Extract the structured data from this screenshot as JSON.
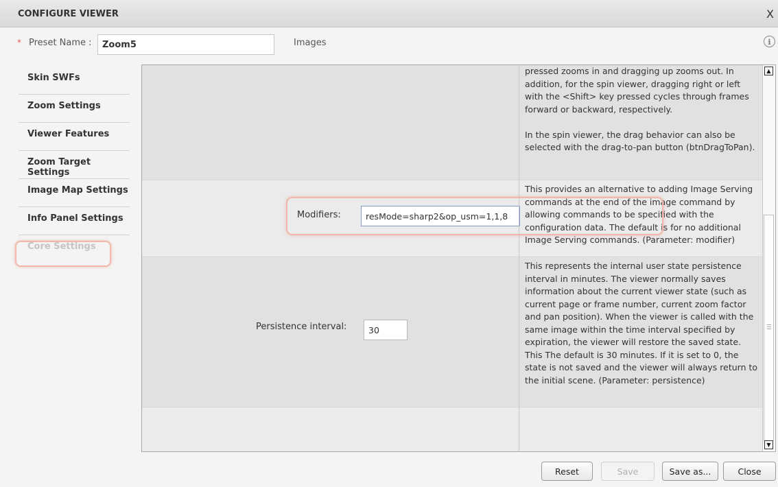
{
  "window": {
    "title": "CONFIGURE VIEWER",
    "close_label": "X"
  },
  "preset": {
    "required_mark": "*",
    "label": "Preset Name :",
    "value": "Zoom5",
    "images_label": "Images",
    "info_icon": "info-icon"
  },
  "sidebar": {
    "items": [
      {
        "label": "Skin SWFs"
      },
      {
        "label": "Zoom Settings"
      },
      {
        "label": "Viewer Features"
      },
      {
        "label": "Zoom Target Settings"
      },
      {
        "label": "Image Map Settings"
      },
      {
        "label": "Info Panel Settings"
      },
      {
        "label": "Core Settings"
      }
    ],
    "active": "Core Settings"
  },
  "rows": {
    "drag_desc": "pressed zooms in and dragging up zooms out. In addition, for the spin viewer, dragging right or left with the <Shift> key pressed cycles through frames forward or backward, respectively.\n\nIn the spin viewer, the drag behavior can also be selected with the drag-to-pan button (btnDragToPan).",
    "modifiers": {
      "label": "Modifiers:",
      "value": "resMode=sharp2&op_usm=1,1,8",
      "desc": "This provides an alternative to adding Image Serving commands at the end of the image command by allowing commands to be specified with the configuration data. The default is for no additional Image Serving commands. (Parameter: modifier)"
    },
    "persistence": {
      "label": "Persistence interval:",
      "value": "30",
      "desc": "This represents the internal user state persistence interval in minutes. The viewer normally saves information about the current viewer state (such as current page or frame number, current zoom factor and pan position). When the viewer is called with the same image within the time interval specified by expiration, the viewer will restore the saved state. This The default is 30 minutes. If it is set to 0, the state is not saved and the viewer will always return to the initial scene. (Parameter: persistence)"
    }
  },
  "buttons": {
    "reset": "Reset",
    "save": "Save",
    "save_as": "Save as...",
    "close": "Close"
  },
  "colors": {
    "highlight": "#f2b6ab",
    "required": "#e8574a",
    "inactive_nav": "#c4c4c4"
  }
}
